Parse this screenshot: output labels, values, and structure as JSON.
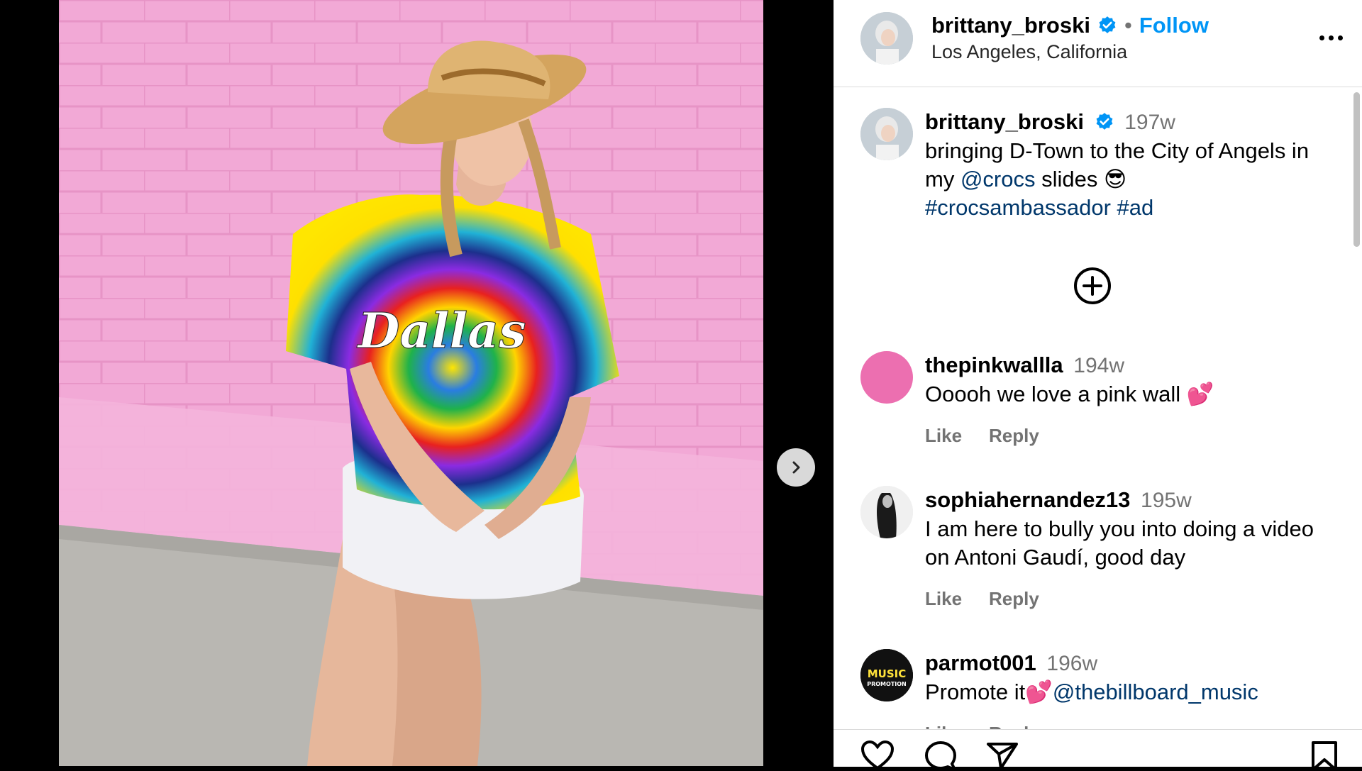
{
  "post": {
    "author": "brittany_broski",
    "follow_label": "Follow",
    "separator": "•",
    "location": "Los Angeles, California",
    "more_label": "More options"
  },
  "caption": {
    "username": "brittany_broski",
    "time": "197w",
    "text_1": "bringing D-Town to the City of Angels in my ",
    "mention": "@crocs",
    "text_2": " slides 😎",
    "hashtags": "#crocsambassador #ad"
  },
  "photo": {
    "shirt_text": "Dallas"
  },
  "comments": [
    {
      "username": "thepinkwallla",
      "time": "194w",
      "text": "Ooooh we love a pink wall 💕",
      "like_label": "Like",
      "reply_label": "Reply"
    },
    {
      "username": "sophiahernandez13",
      "time": "195w",
      "text": "I am here to bully you into doing a video on Antoni Gaudí, good day",
      "like_label": "Like",
      "reply_label": "Reply"
    },
    {
      "username": "parmot001",
      "time": "196w",
      "text": "Promote it💕",
      "mention": "@thebillboard_music",
      "like_label": "Like",
      "reply_label": "Reply",
      "avatar_text_1": "MUSIC",
      "avatar_text_2": "PROMOTION"
    }
  ],
  "colors": {
    "follow_blue": "#0095f6",
    "link_navy": "#00376b",
    "muted_gray": "#737373",
    "wall_pink": "#f0a6d4"
  },
  "icons": [
    "chevron-right-icon",
    "verified-badge-icon",
    "more-options-icon",
    "plus-circle-icon",
    "heart-icon",
    "comment-icon",
    "share-icon",
    "bookmark-icon"
  ]
}
